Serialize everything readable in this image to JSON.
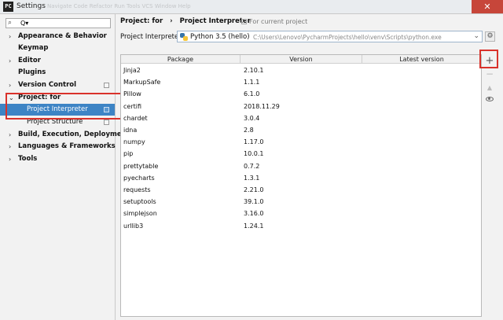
{
  "window": {
    "title": "Settings",
    "app_icon": "PC",
    "ghost_menu": "Navigate  Code  Refactor  Run  Tools  VCS  Window  Help",
    "close_glyph": "✕"
  },
  "search": {
    "value": "Q▾",
    "placeholder": ""
  },
  "sidebar": {
    "items": [
      {
        "label": "Appearance & Behavior",
        "arrow": "›"
      },
      {
        "label": "Keymap",
        "arrow": ""
      },
      {
        "label": "Editor",
        "arrow": "›"
      },
      {
        "label": "Plugins",
        "arrow": ""
      },
      {
        "label": "Version Control",
        "arrow": "›"
      },
      {
        "label": "Project: for",
        "arrow": "⌄"
      },
      {
        "label": "Project Interpreter",
        "arrow": ""
      },
      {
        "label": "Project Structure",
        "arrow": ""
      },
      {
        "label": "Build, Execution, Deployment",
        "arrow": "›"
      },
      {
        "label": "Languages & Frameworks",
        "arrow": "›"
      },
      {
        "label": "Tools",
        "arrow": "›"
      }
    ]
  },
  "breadcrumb": {
    "project": "Project: for",
    "separator": "›",
    "page": "Project Interpreter"
  },
  "for_current_project": "For current project",
  "interpreter": {
    "label": "Project Interpreter:",
    "name": "Python 3.5 (hello)",
    "path": "C:\\Users\\Lenovo\\PycharmProjects\\hello\\venv\\Scripts\\python.exe"
  },
  "table": {
    "headers": [
      "Package",
      "Version",
      "Latest version"
    ],
    "rows": [
      [
        "Jinja2",
        "2.10.1",
        ""
      ],
      [
        "MarkupSafe",
        "1.1.1",
        ""
      ],
      [
        "Pillow",
        "6.1.0",
        ""
      ],
      [
        "certifi",
        "2018.11.29",
        ""
      ],
      [
        "chardet",
        "3.0.4",
        ""
      ],
      [
        "idna",
        "2.8",
        ""
      ],
      [
        "numpy",
        "1.17.0",
        ""
      ],
      [
        "pip",
        "10.0.1",
        ""
      ],
      [
        "prettytable",
        "0.7.2",
        ""
      ],
      [
        "pyecharts",
        "1.3.1",
        ""
      ],
      [
        "requests",
        "2.21.0",
        ""
      ],
      [
        "setuptools",
        "39.1.0",
        ""
      ],
      [
        "simplejson",
        "3.16.0",
        ""
      ],
      [
        "urllib3",
        "1.24.1",
        ""
      ]
    ]
  },
  "tools": {
    "add": "+",
    "remove": "−",
    "upgrade": "▲"
  },
  "colors": {
    "selection": "#3d84c5",
    "highlight_box": "#d9322b"
  }
}
